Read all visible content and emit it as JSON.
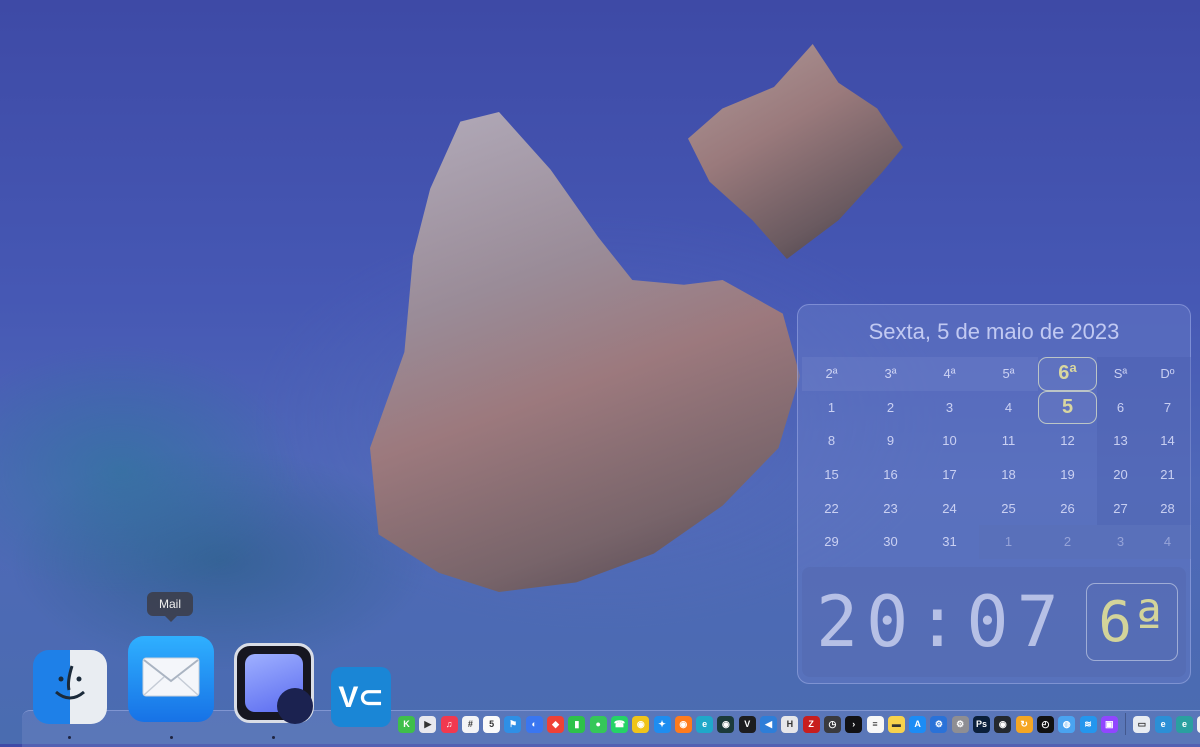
{
  "calendar": {
    "title": "Sexta, 5 de maio de 2023",
    "weekdays": [
      "2ª",
      "3ª",
      "4ª",
      "5ª",
      "6ª",
      "Sª",
      "Dº"
    ],
    "today_weekday_index": 4,
    "weeks": [
      [
        "1",
        "2",
        "3",
        "4",
        "5",
        "6",
        "7"
      ],
      [
        "8",
        "9",
        "10",
        "11",
        "12",
        "13",
        "14"
      ],
      [
        "15",
        "16",
        "17",
        "18",
        "19",
        "20",
        "21"
      ],
      [
        "22",
        "23",
        "24",
        "25",
        "26",
        "27",
        "28"
      ],
      [
        "29",
        "30",
        "31",
        "1",
        "2",
        "3",
        "4"
      ]
    ],
    "today": "5",
    "clock_time": "20:07",
    "clock_day": "6ª"
  },
  "dock": {
    "tooltip": "Mail",
    "apps": [
      {
        "name": "finder",
        "icon": "finder-icon"
      },
      {
        "name": "mail",
        "icon": "envelope-icon"
      },
      {
        "name": "preview",
        "icon": "preview-icon"
      },
      {
        "name": "vnc",
        "icon": "vnc-icon",
        "label": "V⊂"
      }
    ],
    "small_icons": [
      {
        "icon": "k-app-icon",
        "color": "#3fbf4a",
        "glyph": "K"
      },
      {
        "icon": "play-icon",
        "color": "#e8e8ee",
        "glyph": "▶"
      },
      {
        "icon": "music-icon",
        "color": "#f1394f",
        "glyph": "♫"
      },
      {
        "icon": "slack-icon",
        "color": "#f4f4f6",
        "glyph": "#"
      },
      {
        "icon": "calendar-icon",
        "color": "#fafafa",
        "glyph": "5"
      },
      {
        "icon": "flag-icon",
        "color": "#2f8fe5",
        "glyph": "⚑"
      },
      {
        "icon": "signal-icon",
        "color": "#3a76f0",
        "glyph": "◐"
      },
      {
        "icon": "anydesk-icon",
        "color": "#ef4136",
        "glyph": "◆"
      },
      {
        "icon": "facetime-icon",
        "color": "#2ec24a",
        "glyph": "▮"
      },
      {
        "icon": "messages-icon",
        "color": "#35c759",
        "glyph": "●"
      },
      {
        "icon": "whatsapp-icon",
        "color": "#25d366",
        "glyph": "☎"
      },
      {
        "icon": "chrome-icon",
        "color": "#f0c419",
        "glyph": "◉"
      },
      {
        "icon": "safari-icon",
        "color": "#1e8df0",
        "glyph": "✦"
      },
      {
        "icon": "firefox-icon",
        "color": "#ff7b1c",
        "glyph": "◉"
      },
      {
        "icon": "edge-icon",
        "color": "#1fa8c9",
        "glyph": "e"
      },
      {
        "icon": "app-icon",
        "color": "#1c3a3a",
        "glyph": "◉"
      },
      {
        "icon": "vectorworks-icon",
        "color": "#1d1d1f",
        "glyph": "V"
      },
      {
        "icon": "vscode-icon",
        "color": "#2e7ed8",
        "glyph": "◀"
      },
      {
        "icon": "h-icon",
        "color": "#e6e6ea",
        "glyph": "H"
      },
      {
        "icon": "filezilla-icon",
        "color": "#c81e1e",
        "glyph": "Z"
      },
      {
        "icon": "clock-icon",
        "color": "#3a3a3e",
        "glyph": "◷"
      },
      {
        "icon": "terminal-icon",
        "color": "#111114",
        "glyph": "›"
      },
      {
        "icon": "notes-icon",
        "color": "#f7f7f7",
        "glyph": "≡"
      },
      {
        "icon": "stickies-icon",
        "color": "#f7d24c",
        "glyph": "▬"
      },
      {
        "icon": "appstore-icon",
        "color": "#1c8cf5",
        "glyph": "A"
      },
      {
        "icon": "settings-icon",
        "color": "#2a72d8",
        "glyph": "⚙"
      },
      {
        "icon": "system-prefs-icon",
        "color": "#8e8e93",
        "glyph": "⚙"
      },
      {
        "icon": "photoshop-icon",
        "color": "#0b1f3a",
        "glyph": "Ps"
      },
      {
        "icon": "github-icon",
        "color": "#24292f",
        "glyph": "◉"
      },
      {
        "icon": "sync-icon",
        "color": "#f5a623",
        "glyph": "↻"
      },
      {
        "icon": "clock-app-icon",
        "color": "#111111",
        "glyph": "◴"
      },
      {
        "icon": "network-icon",
        "color": "#4aa3f0",
        "glyph": "◍"
      },
      {
        "icon": "docker-icon",
        "color": "#2496ed",
        "glyph": "≋"
      },
      {
        "icon": "twitch-icon",
        "color": "#9146ff",
        "glyph": "▣"
      },
      {
        "icon": "finder-window-icon",
        "color": "#e8ecf2",
        "glyph": "▭"
      },
      {
        "icon": "edge-beta-icon",
        "color": "#2c8fd6",
        "glyph": "e"
      },
      {
        "icon": "edge-dev-icon",
        "color": "#2aa0a0",
        "glyph": "e"
      },
      {
        "icon": "document-icon",
        "color": "#f2f2f2",
        "glyph": "▯"
      }
    ]
  }
}
